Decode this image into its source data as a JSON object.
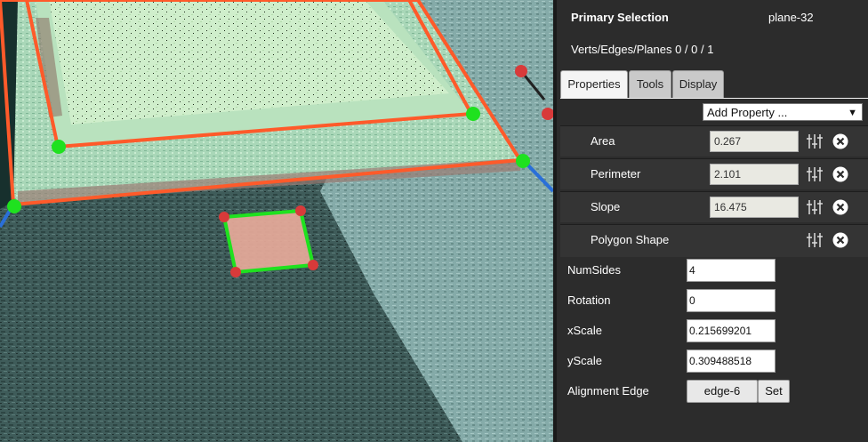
{
  "panel": {
    "title": "Primary Selection",
    "selected_name": "plane-32",
    "counts": "Verts/Edges/Planes 0 / 0 / 1",
    "tabs": [
      {
        "label": "Properties",
        "active": true
      },
      {
        "label": "Tools",
        "active": false
      },
      {
        "label": "Display",
        "active": false
      }
    ],
    "add_property": {
      "label": "Add Property ...",
      "arrow": "▼"
    },
    "properties": [
      {
        "label": "Area",
        "value": "0.267"
      },
      {
        "label": "Perimeter",
        "value": "2.101"
      },
      {
        "label": "Slope",
        "value": "16.475"
      },
      {
        "label": "Polygon Shape"
      }
    ],
    "polygon_fields": [
      {
        "label": "NumSides",
        "value": "4"
      },
      {
        "label": "Rotation",
        "value": "0"
      },
      {
        "label": "xScale",
        "value": "0.215699201"
      },
      {
        "label": "yScale",
        "value": "0.309488518"
      }
    ],
    "alignment": {
      "label": "Alignment Edge",
      "edge_button": "edge-6",
      "set_button": "Set"
    }
  },
  "viewport": {
    "description_colors": {
      "selection_outline": "#ff5a2a",
      "vertex_green": "#1fe11f",
      "vertex_red": "#d83a3a",
      "axis_blue": "#2a6fd8",
      "roof_green": "#c8ecc0",
      "ground_teal": "#3f5e5c"
    },
    "icons": [
      "sliders-icon",
      "close-icon"
    ]
  }
}
